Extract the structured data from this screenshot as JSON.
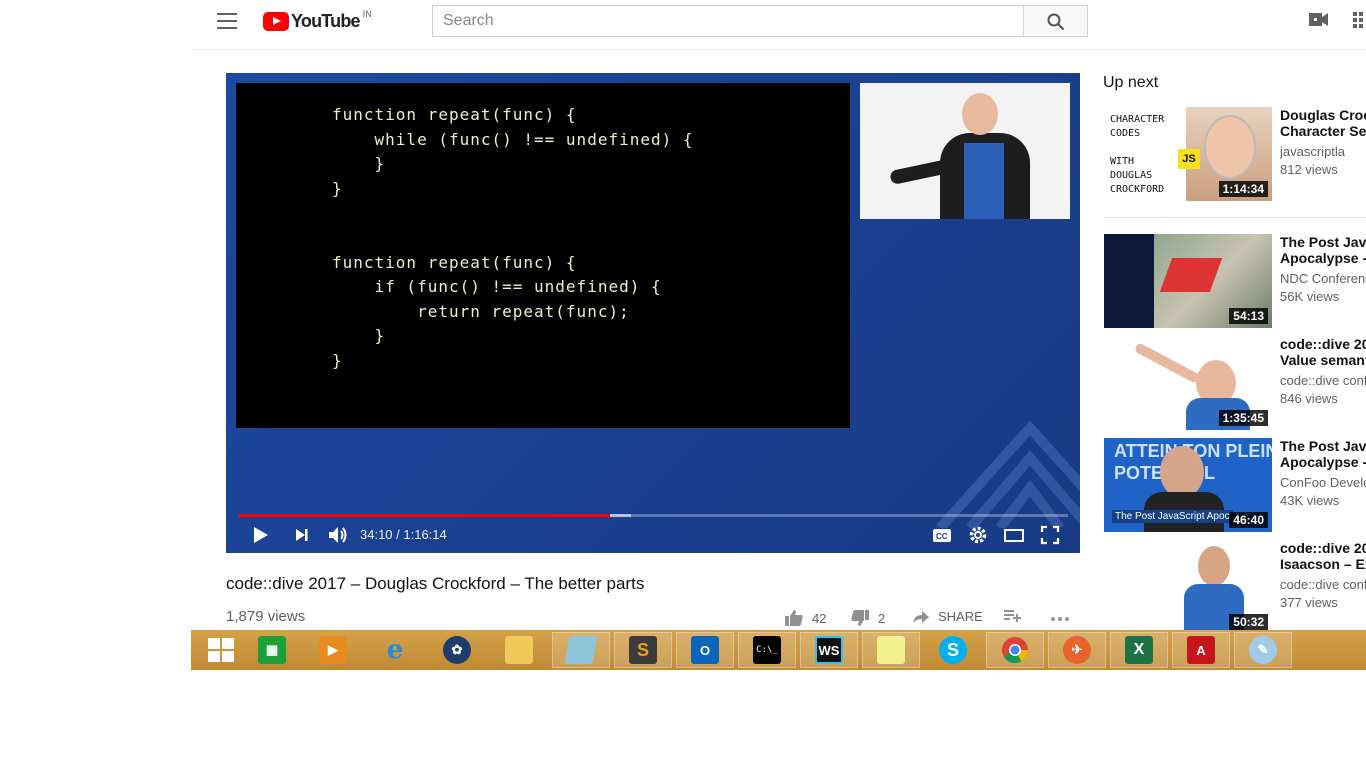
{
  "header": {
    "logo_text": "YouTube",
    "region": "IN",
    "search_placeholder": "Search"
  },
  "player": {
    "time_display": "34:10 / 1:16:14",
    "progress_played": 0.448,
    "progress_buffered": 0.473,
    "slide_code": "function repeat(func) {\n    while (func() !== undefined) {\n    }\n}\n\n\nfunction repeat(func) {\n    if (func() !== undefined) {\n        return repeat(func);\n    }\n}"
  },
  "video": {
    "title": "code::dive 2017 – Douglas Crockford – The better parts",
    "views": "1,879 views",
    "likes": "42",
    "dislikes": "2",
    "share_label": "SHARE"
  },
  "sidebar": {
    "heading": "Up next",
    "items": [
      {
        "title": "Douglas Crock\nCharacter Set",
        "channel": "javascriptla",
        "views": "812 views",
        "duration": "1:14:34",
        "thumb_text": "CHARACTER\nCODES\n\nWITH\nDOUGLAS\nCROCKFORD",
        "thumb_badge": "JS"
      },
      {
        "title": "The Post Java\nApocalypse - I",
        "channel": "NDC Conferenc",
        "views": "56K views",
        "duration": "54:13"
      },
      {
        "title": "code::dive 201\nValue semant",
        "channel": "code::dive conf",
        "views": "846 views",
        "duration": "1:35:45"
      },
      {
        "title": "The Post Java\nApocalypse -",
        "channel": "ConFoo Develo",
        "views": "43K views",
        "duration": "46:40",
        "thumb_text": "ATTEIN TON PLEIN\nPOTENTIEL",
        "thumb_caption": "The Post JavaScript Apoc"
      },
      {
        "title": "code::dive 201\nIsaacson – Ex",
        "channel": "code::dive conf",
        "views": "377 views",
        "duration": "50:32"
      }
    ]
  },
  "taskbar": {
    "apps": [
      "start",
      "store",
      "media",
      "ie",
      "app",
      "explorer",
      "notepad",
      "sublime",
      "outlook",
      "cmd",
      "webstorm",
      "sticky",
      "skype",
      "chrome",
      "tool",
      "excel",
      "acrobat",
      "paint"
    ],
    "cmd_label": "C:\\_",
    "ws_label": "WS"
  },
  "colors": {
    "yt_red": "#ff0000",
    "player_blue": "#1a3f8f",
    "taskbar": "#c8963e",
    "code_text": "#e9f3c4"
  }
}
